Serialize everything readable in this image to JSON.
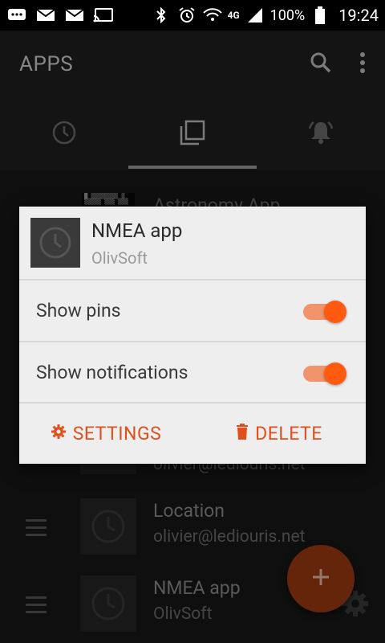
{
  "status_bar": {
    "network": "4G",
    "battery": "100%",
    "time": "19:24"
  },
  "app_bar": {
    "title": "APPS",
    "search_icon": "search-icon",
    "more_icon": "more-vert-icon"
  },
  "tabs": [
    {
      "icon": "clock-icon",
      "selected": false
    },
    {
      "icon": "copy-icon",
      "selected": true
    },
    {
      "icon": "notification-bell-icon",
      "selected": false
    }
  ],
  "list": {
    "background_items": [
      {
        "title": "Astronomy App"
      },
      {
        "subtitle": "olivier@lediouris.net"
      },
      {
        "title": "Location",
        "subtitle": "olivier@lediouris.net"
      },
      {
        "title": "NMEA app",
        "subtitle": "OlivSoft"
      }
    ]
  },
  "dialog": {
    "title": "NMEA app",
    "subtitle": "OlivSoft",
    "toggles": [
      {
        "label": "Show pins",
        "enabled": true
      },
      {
        "label": "Show notifications",
        "enabled": true
      }
    ],
    "settings_label": "SETTINGS",
    "delete_label": "DELETE"
  },
  "fab": {
    "icon": "plus-icon"
  },
  "colors": {
    "accent": "#ff5a0f",
    "accent_text": "#e0501c",
    "track": "#f1946b",
    "fab": "#9a3a12"
  }
}
